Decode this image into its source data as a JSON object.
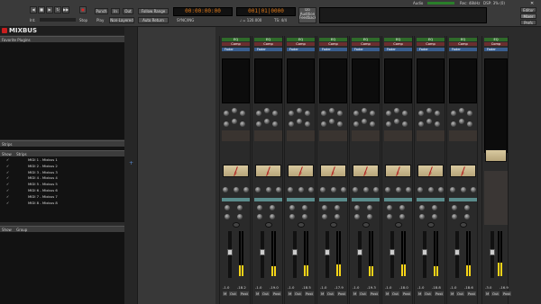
{
  "toolbar": {
    "midi_label": "Int.",
    "stop_label": "Stop",
    "punch_label": "Punch",
    "in_label": "In",
    "out_label": "Out",
    "follow_range_label": "Follow Range",
    "play_label": "Play",
    "nonlinked_label": "Non-Layered",
    "auto_return_label": "Auto Return",
    "primary_clock": "00:00:00:00",
    "secondary_clock": "001|01|0000",
    "tempo": "♩ = 120.000",
    "meter": "TS: 4/4",
    "solo_label": "Do Audition Feedback",
    "audio_label": "Audio",
    "rec_label": "Rec: 48kHz",
    "dsp_label": "DSP: 3% (0)",
    "editor_label": "Editor",
    "mixer_label": "Mixer",
    "prefs_label": "Prefs",
    "sync_label": "SYNC/ING"
  },
  "logo": "MIXBUS",
  "sidebar": {
    "favorite_plugins_title": "Favorite Plugins",
    "strips_title": "Strips",
    "show_col": "Show",
    "strips_col": "Strips",
    "tracks": [
      {
        "name": "MIDI 1 - Mixbus 1",
        "checked": true
      },
      {
        "name": "MIDI 2 - Mixbus 2",
        "checked": true
      },
      {
        "name": "MIDI 3 - Mixbus 3",
        "checked": true
      },
      {
        "name": "MIDI 4 - Mixbus 4",
        "checked": true
      },
      {
        "name": "MIDI 5 - Mixbus 5",
        "checked": true
      },
      {
        "name": "MIDI 6 - Mixbus 6",
        "checked": true
      },
      {
        "name": "MIDI 7 - Mixbus 7",
        "checked": true
      },
      {
        "name": "MIDI 8 - Mixbus 8",
        "checked": true
      }
    ],
    "groups_title_show": "Show",
    "groups_title": "Group"
  },
  "strips": [
    {
      "eq": "EQ",
      "comp": "Comp",
      "plugin": "Fader",
      "gain": "-1.0",
      "peak": "-18.2",
      "meter": 0.25,
      "fader": 0.55
    },
    {
      "eq": "EQ",
      "comp": "Comp",
      "plugin": "Fader",
      "gain": "-1.0",
      "peak": "-19.0",
      "meter": 0.22,
      "fader": 0.55
    },
    {
      "eq": "EQ",
      "comp": "Comp",
      "plugin": "Fader",
      "gain": "-1.0",
      "peak": "-18.5",
      "meter": 0.24,
      "fader": 0.55
    },
    {
      "eq": "EQ",
      "comp": "Comp",
      "plugin": "Fader",
      "gain": "-1.0",
      "peak": "-17.9",
      "meter": 0.26,
      "fader": 0.55
    },
    {
      "eq": "EQ",
      "comp": "Comp",
      "plugin": "Fader",
      "gain": "-1.0",
      "peak": "-19.3",
      "meter": 0.23,
      "fader": 0.55
    },
    {
      "eq": "EQ",
      "comp": "Comp",
      "plugin": "Fader",
      "gain": "-1.0",
      "peak": "-18.0",
      "meter": 0.27,
      "fader": 0.55
    },
    {
      "eq": "EQ",
      "comp": "Comp",
      "plugin": "Fader",
      "gain": "-1.0",
      "peak": "-18.8",
      "meter": 0.22,
      "fader": 0.55
    },
    {
      "eq": "EQ",
      "comp": "Comp",
      "plugin": "Fader",
      "gain": "-1.0",
      "peak": "-18.6",
      "meter": 0.24,
      "fader": 0.55
    }
  ],
  "master": {
    "eq": "EQ",
    "comp": "Comp",
    "plugin": "Fader",
    "gain": "-3.0",
    "peak": "-16.9",
    "meter": 0.3,
    "fader": 0.55
  },
  "strip_buttons": {
    "m": "M",
    "s": "S",
    "out": "Out",
    "post": "Post",
    "trim": "Trim",
    "vu_tick": "0"
  },
  "colors": {
    "eq": "#2f6b2a",
    "comp": "#6a2f2f",
    "plugin": "#3a5f8f",
    "clock": "#e07a1a",
    "meter": "#f7d417"
  }
}
